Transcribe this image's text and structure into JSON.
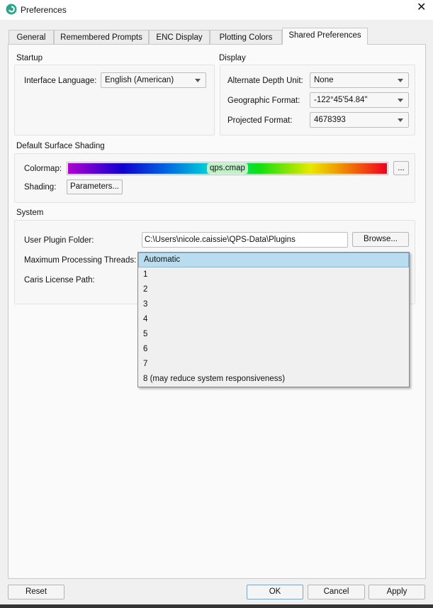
{
  "window": {
    "title": "Preferences"
  },
  "tabs": [
    {
      "label": "General"
    },
    {
      "label": "Remembered Prompts"
    },
    {
      "label": "ENC Display"
    },
    {
      "label": "Plotting Colors"
    },
    {
      "label": "Shared Preferences",
      "active": true
    }
  ],
  "startup": {
    "title": "Startup",
    "interface_language_label": "Interface Language:",
    "interface_language_value": "English (American)"
  },
  "display": {
    "title": "Display",
    "alt_depth_label": "Alternate Depth Unit:",
    "alt_depth_value": "None",
    "geo_format_label": "Geographic Format:",
    "geo_format_value": "-122°45'54.84\"",
    "proj_format_label": "Projected Format:",
    "proj_format_value": "4678393"
  },
  "shading": {
    "title": "Default Surface Shading",
    "colormap_label": "Colormap:",
    "colormap_value": "qps.cmap",
    "browse_label": "...",
    "shading_label": "Shading:",
    "parameters_label": "Parameters..."
  },
  "system": {
    "title": "System",
    "plugin_folder_label": "User Plugin Folder:",
    "plugin_folder_value": "C:\\Users\\nicole.caissie\\QPS-Data\\Plugins",
    "browse_label": "Browse...",
    "threads_label": "Maximum Processing Threads:",
    "license_label": "Caris License Path:",
    "threads_options": [
      "Automatic",
      "1",
      "2",
      "3",
      "4",
      "5",
      "6",
      "7",
      "8 (may reduce system responsiveness)"
    ],
    "threads_selected": "Automatic"
  },
  "buttons": {
    "reset": "Reset",
    "ok": "OK",
    "cancel": "Cancel",
    "apply": "Apply"
  },
  "colors": {
    "accent": "#b9dcee",
    "app_icon": "#2aa58c"
  }
}
